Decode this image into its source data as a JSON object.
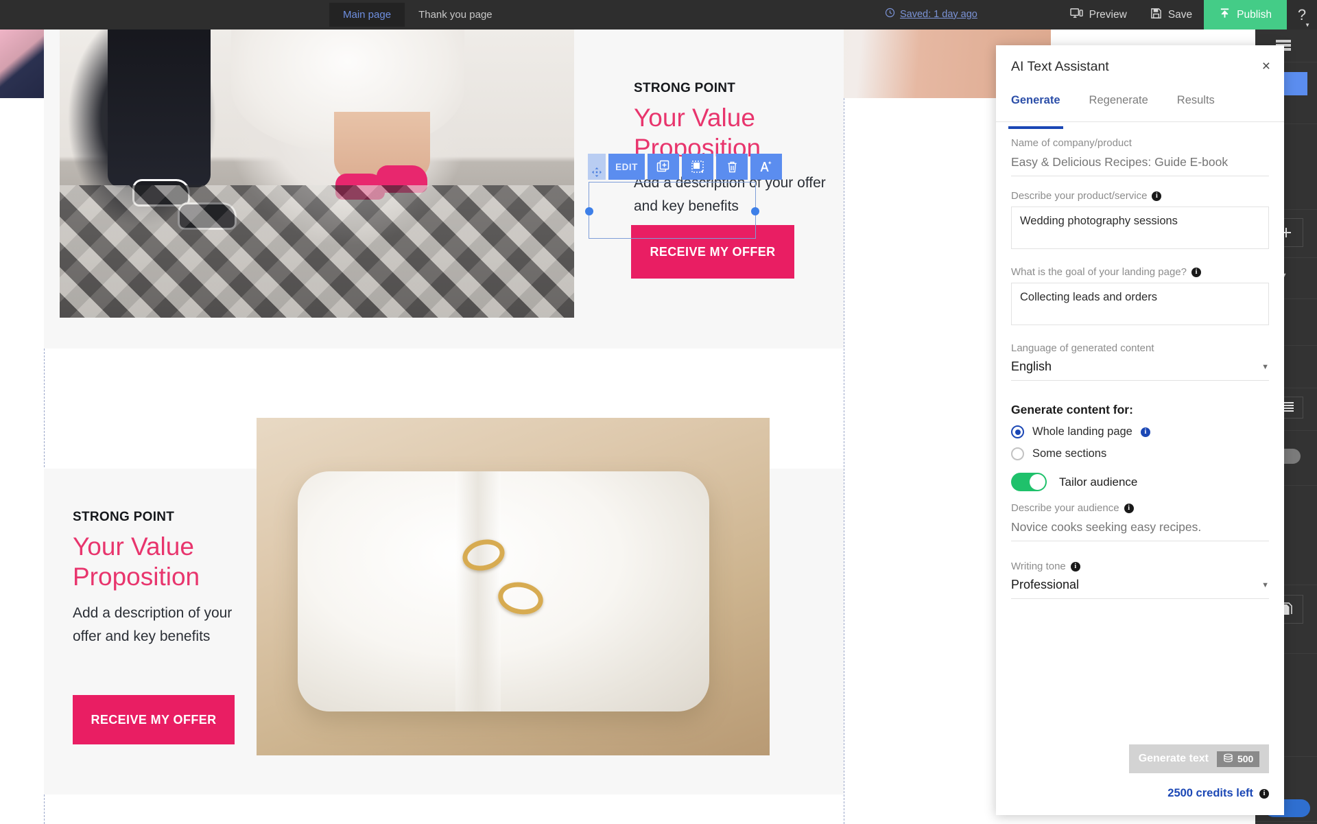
{
  "topbar": {
    "tabs": [
      {
        "label": "Main page",
        "active": true
      },
      {
        "label": "Thank you page",
        "active": false
      }
    ],
    "saved_status": "Saved: 1 day ago",
    "saved_icon": "clock-icon",
    "preview_label": "Preview",
    "save_label": "Save",
    "publish_label": "Publish",
    "help_label": "?",
    "publish_color": "#44cc87",
    "background": "#2e2e2e"
  },
  "canvas": {
    "hero": {
      "eyebrow": "STRONG POINT",
      "headline": "Your Value Proposition",
      "body": "Add a description of your offer and key benefits",
      "cta_label": "RECEIVE MY OFFER"
    },
    "section2": {
      "eyebrow": "STRONG POINT",
      "headline": "Your Value Proposition",
      "body": "Add a description of your offer and key benefits",
      "cta_label": "RECEIVE MY OFFER"
    },
    "accent_color": "#e91e63",
    "edit_toolbar": {
      "move_icon": "move-handle-icon",
      "edit_label": "EDIT",
      "duplicate_icon": "duplicate-icon",
      "resize_icon": "resize-icon",
      "delete_icon": "trash-icon",
      "ai_icon": "ai-magic-text-icon"
    }
  },
  "ai_panel": {
    "title": "AI Text Assistant",
    "close_icon": "close-icon",
    "tabs": [
      {
        "label": "Generate",
        "active": true
      },
      {
        "label": "Regenerate",
        "active": false
      },
      {
        "label": "Results",
        "active": false
      }
    ],
    "fields": {
      "company_name": {
        "label": "Name of company/product",
        "value": "",
        "placeholder": "Easy & Delicious Recipes: Guide E-book"
      },
      "product_description": {
        "label": "Describe your product/service",
        "value": "Wedding photography sessions",
        "has_info": true
      },
      "landing_goal": {
        "label": "What is the goal of your landing page?",
        "value": "Collecting leads and orders",
        "has_info": true
      },
      "language": {
        "label": "Language of generated content",
        "value": "English",
        "caret_icon": "chevron-down-icon"
      },
      "generate_for": {
        "label": "Generate content for:",
        "options": [
          {
            "label": "Whole landing page",
            "selected": true,
            "has_info": true
          },
          {
            "label": "Some sections",
            "selected": false,
            "has_info": false
          }
        ]
      },
      "tailor_audience": {
        "label": "Tailor audience",
        "enabled": true,
        "color": "#1fc16b"
      },
      "audience_description": {
        "label": "Describe your audience",
        "value": "",
        "placeholder": "Novice cooks seeking easy recipes.",
        "has_info": true
      },
      "writing_tone": {
        "label": "Writing tone",
        "value": "Professional",
        "has_info": true,
        "caret_icon": "chevron-down-icon"
      }
    },
    "generate_button": {
      "label": "Generate text",
      "cost": "500",
      "cost_icon": "credits-coin-icon",
      "disabled": true
    },
    "credits_left": "2500 credits left",
    "credits_info_icon": "info-icon",
    "link_color": "#1b47b5"
  },
  "right_rail": {
    "background": "#333333",
    "items": [
      {
        "icon": "list-layers-icon"
      },
      {
        "icon": "blue-color-swatch"
      },
      {
        "icon": "stepper-icon"
      },
      {
        "icon": "add-plus-icon"
      },
      {
        "icon": "chevron-down-icon"
      },
      {
        "icon": "stepper-icon"
      },
      {
        "icon": "stepper-icon"
      },
      {
        "icon": "lines-align-icon"
      },
      {
        "icon": "toggle-switch"
      },
      {
        "icon": "stepper-icon"
      },
      {
        "icon": "copy-page-icon"
      },
      {
        "icon": "blue-pill-button"
      }
    ]
  }
}
